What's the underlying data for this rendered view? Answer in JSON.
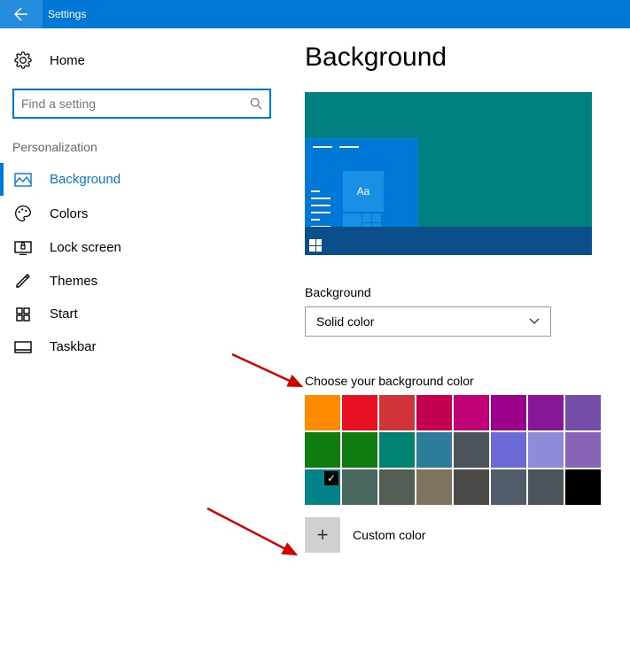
{
  "titlebar": {
    "title": "Settings"
  },
  "sidebar": {
    "home_label": "Home",
    "search_placeholder": "Find a setting",
    "section_label": "Personalization",
    "items": [
      {
        "key": "background",
        "label": "Background",
        "active": true
      },
      {
        "key": "colors",
        "label": "Colors"
      },
      {
        "key": "lockscreen",
        "label": "Lock screen"
      },
      {
        "key": "themes",
        "label": "Themes"
      },
      {
        "key": "start",
        "label": "Start"
      },
      {
        "key": "taskbar",
        "label": "Taskbar"
      }
    ]
  },
  "main": {
    "page_title": "Background",
    "preview_tile_text": "Aa",
    "bg_label": "Background",
    "bg_dropdown_value": "Solid color",
    "color_label": "Choose your background color",
    "custom_color_label": "Custom color",
    "colors_row1": [
      "#ff8c00",
      "#e81123",
      "#d13438",
      "#c30052",
      "#bf0077",
      "#9a0089",
      "#881798",
      "#744da9"
    ],
    "colors_row2": [
      "#107c10",
      "#107c10",
      "#008272",
      "#2d7d9a",
      "#4a5459",
      "#6b69d6",
      "#8e8cd8",
      "#8764b8"
    ],
    "colors_row3": [
      "#038387",
      "#486860",
      "#525e54",
      "#7e735f",
      "#4c4a48",
      "#515c6b",
      "#4a5459",
      "#000000"
    ],
    "selected_color": "#038387"
  }
}
